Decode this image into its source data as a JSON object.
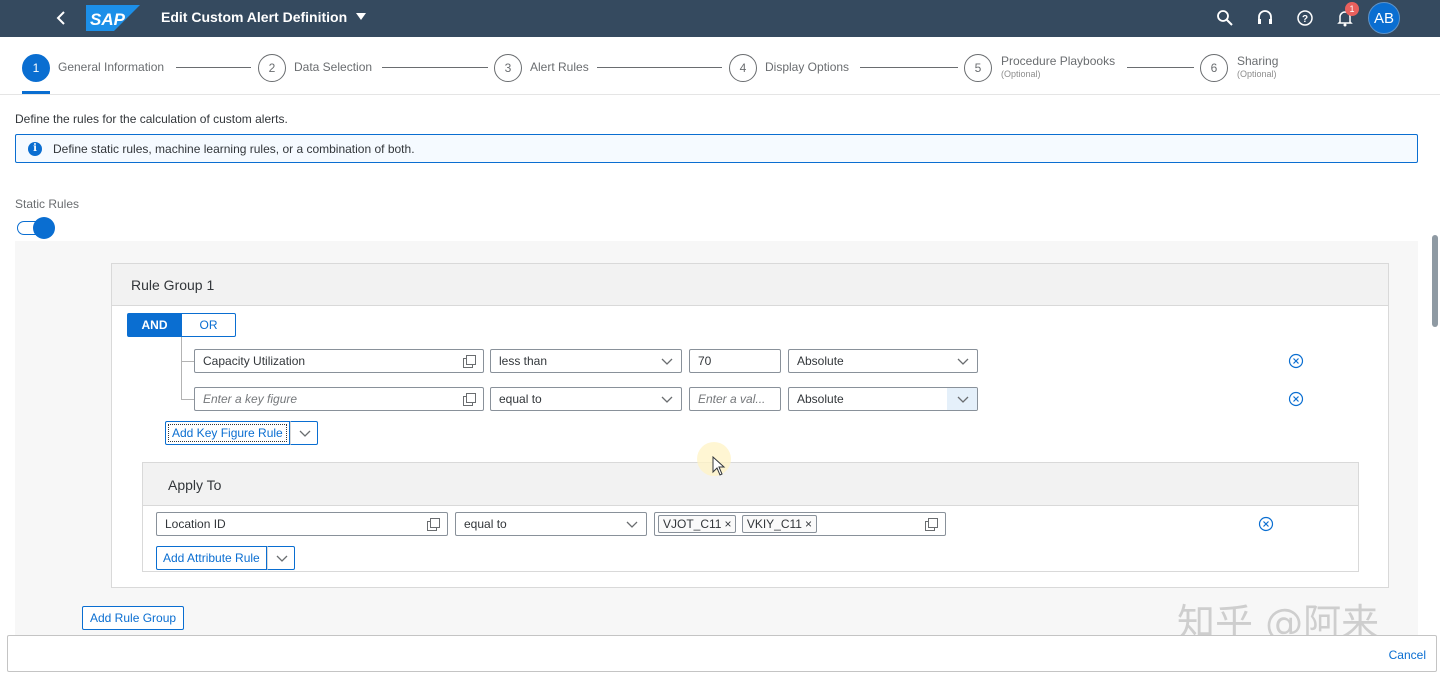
{
  "shell": {
    "title": "Edit Custom Alert Definition",
    "logo_text": "SAP",
    "notification_count": "1",
    "avatar_initials": "AB",
    "icons": [
      "back-icon",
      "search-icon",
      "headset-icon",
      "help-icon",
      "bell-icon"
    ]
  },
  "wizard": {
    "steps": [
      {
        "number": "1",
        "label": "General Information",
        "sub": ""
      },
      {
        "number": "2",
        "label": "Data Selection",
        "sub": ""
      },
      {
        "number": "3",
        "label": "Alert Rules",
        "sub": ""
      },
      {
        "number": "4",
        "label": "Display Options",
        "sub": ""
      },
      {
        "number": "5",
        "label": "Procedure Playbooks",
        "sub": "(Optional)"
      },
      {
        "number": "6",
        "label": "Sharing",
        "sub": "(Optional)"
      }
    ],
    "active_step": "1"
  },
  "content": {
    "description": "Define the rules for the calculation of custom alerts.",
    "info_text": "Define static rules, machine learning rules, or a combination of both.",
    "static_rules_label": "Static Rules",
    "static_rules_on": true
  },
  "rule_group": {
    "title": "Rule Group 1",
    "and_label": "AND",
    "or_label": "OR",
    "rules": [
      {
        "key_figure": "Capacity Utilization",
        "key_figure_placeholder": "Enter a key figure",
        "operator": "less than",
        "value": "70",
        "value_placeholder": "Enter a val...",
        "mode": "Absolute"
      },
      {
        "key_figure": "",
        "key_figure_placeholder": "Enter a key figure",
        "operator": "equal to",
        "value": "",
        "value_placeholder": "Enter a val...",
        "mode": "Absolute"
      }
    ],
    "add_key_figure_rule": "Add Key Figure Rule"
  },
  "apply_to": {
    "title": "Apply To",
    "attribute": "Location ID",
    "operator": "equal to",
    "tokens": [
      "VJOT_C11",
      "VKIY_C11"
    ],
    "add_attribute_rule": "Add Attribute Rule"
  },
  "add_rule_group": "Add Rule Group",
  "footer": {
    "cancel": "Cancel"
  },
  "watermark": "知乎 @阿来",
  "colors": {
    "shell_bg": "#354a5f",
    "accent": "#0a6ed1",
    "panel_header": "#f2f2f2",
    "badge": "#e9605d"
  }
}
